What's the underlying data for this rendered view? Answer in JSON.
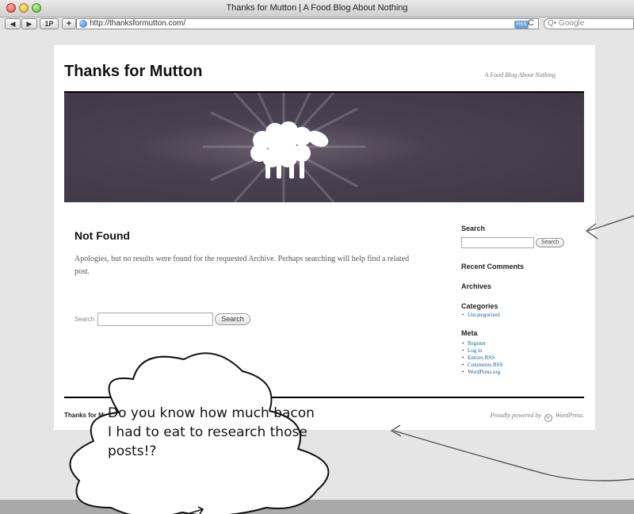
{
  "browser": {
    "window_title": "Thanks for Mutton | A Food Blog About Nothing",
    "back_label": "◀",
    "forward_label": "▶",
    "onepassword_label": "1P",
    "add_label": "+",
    "url": "http://thanksformutton.com/",
    "rss_label": "RSS",
    "reload_label": "C",
    "search_placeholder": "Q• Google"
  },
  "site": {
    "title": "Thanks for Mutton",
    "description": "A Food Blog About Nothing"
  },
  "main": {
    "heading": "Not Found",
    "message": "Apologies, but no results were found for the requested Archive. Perhaps searching will help find a related post.",
    "search_label": "Search",
    "search_button": "Search",
    "search_value": ""
  },
  "sidebar": {
    "search_heading": "Search",
    "search_button": "Search",
    "recent_comments_heading": "Recent Comments",
    "archives_heading": "Archives",
    "categories_heading": "Categories",
    "categories": [
      "Uncategorized"
    ],
    "meta_heading": "Meta",
    "meta_links": [
      "Register",
      "Log in",
      "Entries RSS",
      "Comments RSS",
      "WordPress.org"
    ]
  },
  "footer": {
    "left": "Thanks for Mutton",
    "right_prefix": "Proudly powered by",
    "wp_glyph": "W",
    "right_suffix": "WordPress."
  },
  "annotation": {
    "bubble_text": "Do you know how much bacon I had to eat to research those posts!?"
  },
  "colors": {
    "banner": "#4a4150",
    "link": "#1a5fa8",
    "page_bg": "#e5e5e5"
  }
}
